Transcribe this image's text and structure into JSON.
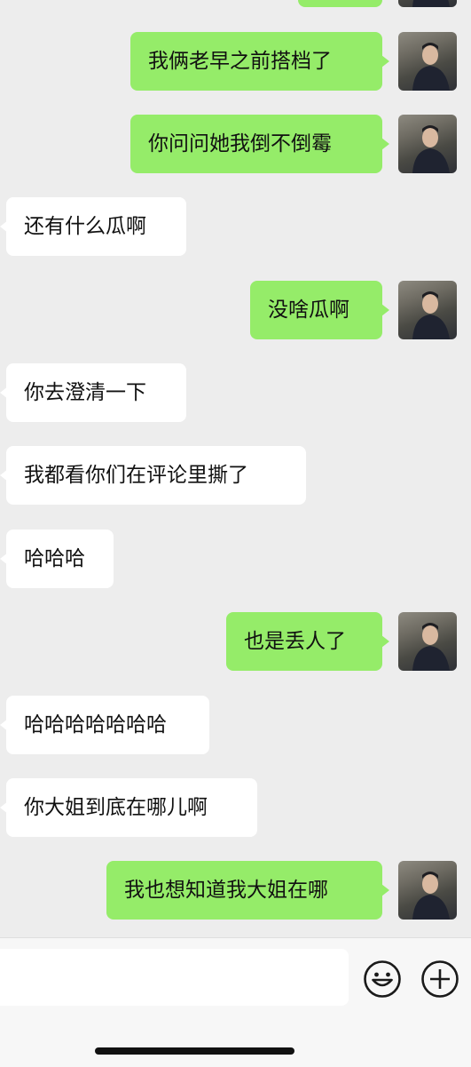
{
  "messages": [
    {
      "side": "me",
      "text": ""
    },
    {
      "side": "me",
      "text": "我俩老早之前搭档了"
    },
    {
      "side": "me",
      "text": "你问问她我倒不倒霉"
    },
    {
      "side": "them",
      "text": "还有什么瓜啊"
    },
    {
      "side": "me",
      "text": "没啥瓜啊"
    },
    {
      "side": "them",
      "text": "你去澄清一下"
    },
    {
      "side": "them",
      "text": "我都看你们在评论里撕了"
    },
    {
      "side": "them",
      "text": "哈哈哈"
    },
    {
      "side": "me",
      "text": "也是丢人了"
    },
    {
      "side": "them",
      "text": "哈哈哈哈哈哈哈"
    },
    {
      "side": "them",
      "text": "你大姐到底在哪儿啊"
    },
    {
      "side": "me",
      "text": "我也想知道我大姐在哪"
    }
  ],
  "input": {
    "value": "",
    "placeholder": ""
  },
  "icons": {
    "emoji": "emoji-icon",
    "add": "plus-icon"
  },
  "colors": {
    "background": "#ededed",
    "my_bubble": "#95ec69",
    "their_bubble": "#ffffff",
    "bar": "#f7f7f7"
  }
}
